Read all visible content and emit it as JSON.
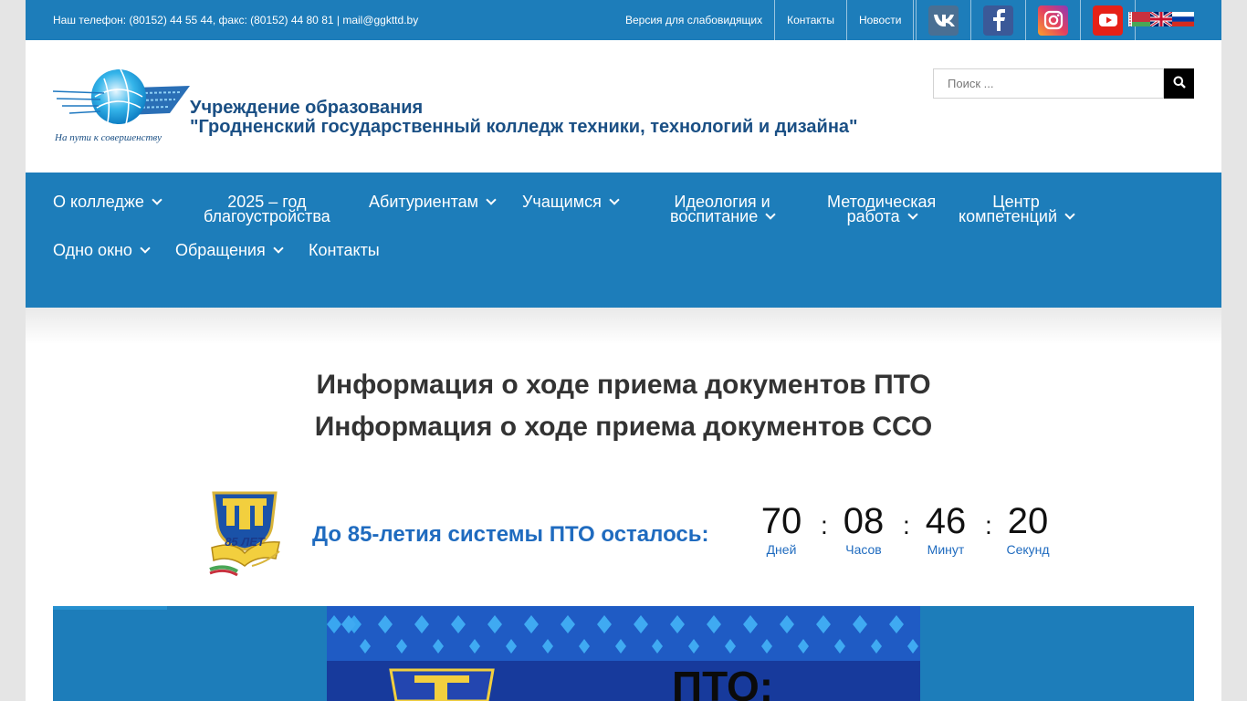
{
  "topbar": {
    "contacts": "Наш телефон: (80152) 44 55 44, факс: (80152) 44 80 81  |  mail@ggkttd.by",
    "links": [
      "Версия для слабовидящих",
      "Контакты",
      "Новости"
    ],
    "socials": [
      "vk-icon",
      "facebook-icon",
      "instagram-icon",
      "youtube-icon"
    ],
    "languages": [
      "be-flag",
      "en-flag",
      "ru-flag"
    ]
  },
  "header": {
    "title_line1": "Учреждение образования",
    "title_line2": "\"Гродненский государственный колледж техники, технологий и дизайна\"",
    "logo_motto": "На пути к совершенству",
    "search_placeholder": "Поиск ..."
  },
  "nav": {
    "items": [
      {
        "label": "О колледже",
        "dropdown": true
      },
      {
        "label_line1": "2025 – год",
        "label_line2": "благоустройства",
        "dropdown": false
      },
      {
        "label": "Абитуриентам",
        "dropdown": true
      },
      {
        "label": "Учащимся",
        "dropdown": true
      },
      {
        "label_line1": "Идеология и",
        "label_line2": "воспитание",
        "dropdown": true
      },
      {
        "label_line1": "Методическая",
        "label_line2": "работа",
        "dropdown": true
      },
      {
        "label_line1": "Центр",
        "label_line2": "компетенций",
        "dropdown": true
      },
      {
        "label": "Одно окно",
        "dropdown": true
      },
      {
        "label": "Обращения",
        "dropdown": true
      },
      {
        "label": "Контакты",
        "dropdown": false
      }
    ]
  },
  "main": {
    "info_links": [
      "Информация о ходе приема документов ПТО",
      "Информация о ходе приема документов ССО"
    ],
    "badge_text": "85 ЛЕТ",
    "countdown_label": "До 85-летия системы ПТО осталось:",
    "countdown": [
      {
        "value": "70",
        "label": "Дней"
      },
      {
        "value": "08",
        "label": "Часов"
      },
      {
        "value": "46",
        "label": "Минут"
      },
      {
        "value": "20",
        "label": "Секунд"
      }
    ],
    "banner_text": "ПТО:"
  },
  "colors": {
    "brand_blue": "#1d7dba",
    "title_blue": "#1a4f84",
    "accent_blue": "#1f6bbf"
  }
}
